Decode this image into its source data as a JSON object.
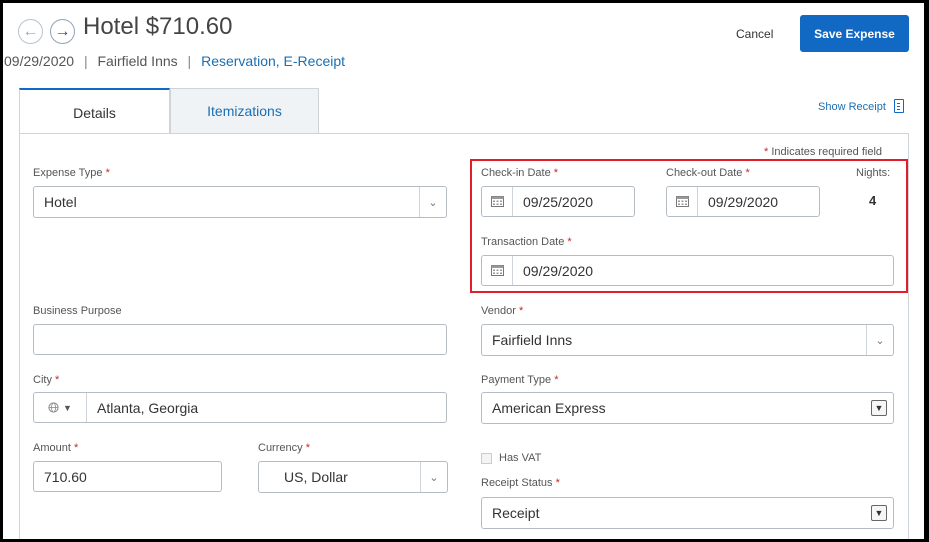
{
  "header": {
    "title": "Hotel $710.60",
    "date": "09/29/2020",
    "vendor": "Fairfield Inns",
    "separator": "|",
    "link": "Reservation, E-Receipt",
    "cancel_label": "Cancel",
    "save_label": "Save Expense",
    "back_glyph": "←",
    "forward_glyph": "→"
  },
  "tabs": [
    {
      "label": "Details",
      "active": true
    },
    {
      "label": "Itemizations",
      "active": false
    }
  ],
  "show_receipt_label": "Show Receipt",
  "required_note": "Indicates required field",
  "required_mark": "*",
  "form": {
    "expense_type": {
      "label": "Expense Type",
      "value": "Hotel"
    },
    "checkin": {
      "label": "Check-in Date",
      "value": "09/25/2020"
    },
    "checkout": {
      "label": "Check-out Date",
      "value": "09/29/2020"
    },
    "nights": {
      "label": "Nights:",
      "value": "4"
    },
    "transaction_date": {
      "label": "Transaction Date",
      "value": "09/29/2020"
    },
    "business_purpose": {
      "label": "Business Purpose",
      "value": ""
    },
    "vendor": {
      "label": "Vendor",
      "value": "Fairfield Inns"
    },
    "city": {
      "label": "City",
      "value": "Atlanta, Georgia"
    },
    "payment_type": {
      "label": "Payment Type",
      "value": "American Express"
    },
    "amount": {
      "label": "Amount",
      "value": "710.60"
    },
    "currency": {
      "label": "Currency",
      "value": "US, Dollar"
    },
    "has_vat": {
      "label": "Has VAT",
      "checked": false
    },
    "receipt_status": {
      "label": "Receipt Status",
      "value": "Receipt"
    }
  },
  "colors": {
    "accent": "#1269c4",
    "required": "#c62828",
    "highlight": "#e01e2c"
  },
  "icons": [
    "back-arrow-icon",
    "forward-arrow-icon",
    "receipt-icon",
    "calendar-icon",
    "globe-icon",
    "chevron-down-icon"
  ]
}
